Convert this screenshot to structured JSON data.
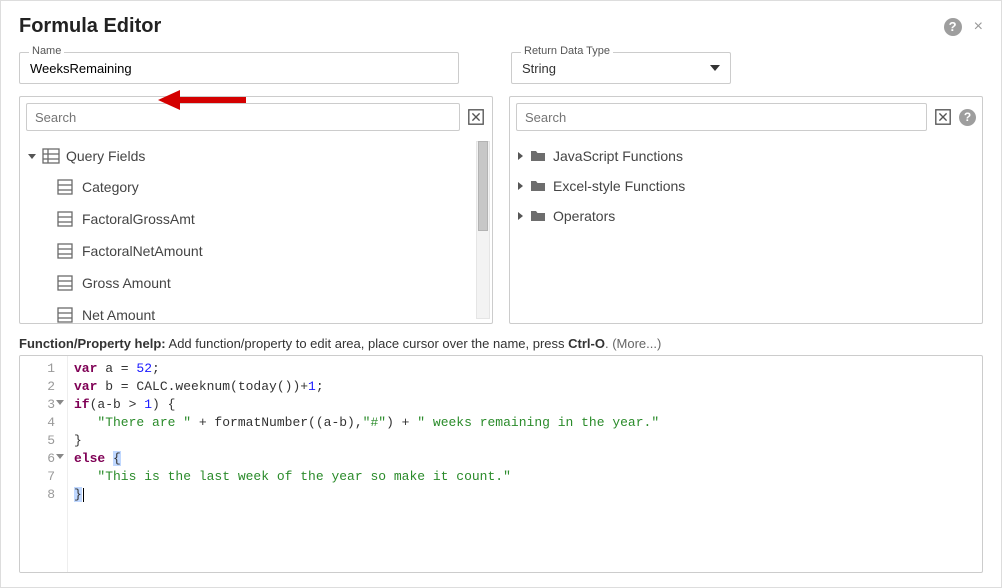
{
  "title": "Formula Editor",
  "nameField": {
    "label": "Name",
    "value": "WeeksRemaining"
  },
  "returnType": {
    "label": "Return Data Type",
    "value": "String"
  },
  "leftPanel": {
    "searchPlaceholder": "Search",
    "rootLabel": "Query Fields",
    "items": [
      "Category",
      "FactoralGrossAmt",
      "FactoralNetAmount",
      "Gross Amount",
      "Net Amount"
    ]
  },
  "rightPanel": {
    "searchPlaceholder": "Search",
    "items": [
      "JavaScript Functions",
      "Excel-style Functions",
      "Operators"
    ]
  },
  "helpLine": {
    "prefix": "Function/Property help:",
    "text": " Add function/property to edit area, place cursor over the name, press ",
    "keys": "Ctrl-O",
    "suffix": ". (More...)"
  },
  "code": {
    "l1_kw1": "var",
    "l1_rest": " a = ",
    "l1_num": "52",
    "l1_semi": ";",
    "l2_kw1": "var",
    "l2_rest": " b = CALC.weeknum(today())+",
    "l2_num": "1",
    "l2_semi": ";",
    "l3_kw1": "if",
    "l3_rest": "(a-b > ",
    "l3_num": "1",
    "l3_tail": ") {",
    "l4_ind": "   ",
    "l4_s1": "\"There are \"",
    "l4_mid": " + formatNumber((a-b),",
    "l4_s2": "\"#\"",
    "l4_mid2": ") + ",
    "l4_s3": "\" weeks remaining in the year.\"",
    "l5": "}",
    "l6_kw": "else",
    "l6_sp": " ",
    "l6_brace": "{",
    "l7_ind": "   ",
    "l7_s": "\"This is the last week of the year so make it count.\"",
    "l8": "}"
  },
  "lineNumbers": [
    "1",
    "2",
    "3",
    "4",
    "5",
    "6",
    "7",
    "8"
  ]
}
